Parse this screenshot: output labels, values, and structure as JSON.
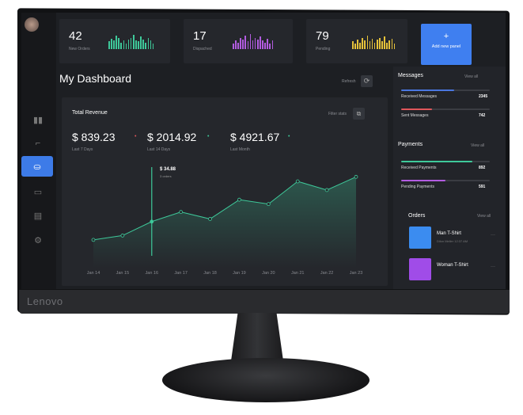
{
  "brand": "Lenovo",
  "colors": {
    "accent": "#3f7ff0",
    "green": "#3ec99a",
    "purple": "#b25ce0",
    "yellow": "#e6c23a",
    "red": "#e0575b",
    "blue": "#4a77e0"
  },
  "sidebar": {
    "icons": [
      "bar-chart-icon",
      "paint-roller-icon",
      "basket-icon",
      "chat-icon",
      "document-icon",
      "gear-icon"
    ],
    "active": 2
  },
  "stats": [
    {
      "value": "42",
      "label": "New Orders",
      "color": "#3ec99a",
      "bars": [
        8,
        11,
        9,
        14,
        12,
        7,
        9,
        6,
        10,
        12,
        15,
        9,
        8,
        13,
        10,
        7,
        12,
        9,
        6
      ]
    },
    {
      "value": "17",
      "label": "Dispached",
      "color": "#b25ce0",
      "bars": [
        6,
        9,
        7,
        12,
        10,
        14,
        8,
        16,
        9,
        12,
        10,
        13,
        9,
        7,
        11,
        6,
        9
      ]
    },
    {
      "value": "79",
      "label": "Pending",
      "color": "#e6c23a",
      "bars": [
        8,
        6,
        10,
        7,
        12,
        9,
        14,
        8,
        11,
        7,
        10,
        12,
        8,
        13,
        7,
        9,
        11,
        6
      ]
    }
  ],
  "add_panel": {
    "icon": "+",
    "label": "Add new panel"
  },
  "header": {
    "title": "My Dashboard",
    "refresh": "Refresh"
  },
  "revenue": {
    "title": "Total Revenue",
    "filter": "Filter stats",
    "summaries": [
      {
        "value": "$ 839.23",
        "label": "Last 7 Days"
      },
      {
        "value": "$ 2014.92",
        "label": "Last 14 Days"
      },
      {
        "value": "$ 4921.67",
        "label": "Last Month"
      }
    ],
    "tooltip": {
      "value": "$ 34.88",
      "sub": "3 orders"
    }
  },
  "chart_data": {
    "type": "area",
    "categories": [
      "Jan 14",
      "Jan 15",
      "Jan 16",
      "Jan 17",
      "Jan 18",
      "Jan 19",
      "Jan 20",
      "Jan 21",
      "Jan 22",
      "Jan 23"
    ],
    "values": [
      24.3,
      26.8,
      34.88,
      40.4,
      36.4,
      47.5,
      45.0,
      58.1,
      53.1,
      60.7
    ],
    "highlight_index": 2,
    "color": "#3ec99a",
    "grid": false
  },
  "messages": {
    "title": "Messages",
    "view_all": "View all",
    "rows": [
      {
        "label": "Received Messages",
        "value": "2345",
        "fill": 0.6,
        "color": "#4a77e0"
      },
      {
        "label": "Sent Messages",
        "value": "742",
        "fill": 0.35,
        "color": "#e0575b"
      }
    ]
  },
  "payments": {
    "title": "Payments",
    "view_all": "View all",
    "rows": [
      {
        "label": "Received Payments",
        "value": "892",
        "fill": 0.8,
        "color": "#3ec99a"
      },
      {
        "label": "Pending Payments",
        "value": "591",
        "fill": 0.5,
        "color": "#b25ce0"
      }
    ]
  },
  "orders": {
    "title": "Orders",
    "view_all": "View all",
    "items": [
      {
        "name": "Man T-Shirt",
        "meta": "Dilon Meller  12:37 AM",
        "color": "#3b8cf0"
      },
      {
        "name": "Woman T-Shirt",
        "meta": "",
        "color": "#a04ce8"
      }
    ]
  }
}
